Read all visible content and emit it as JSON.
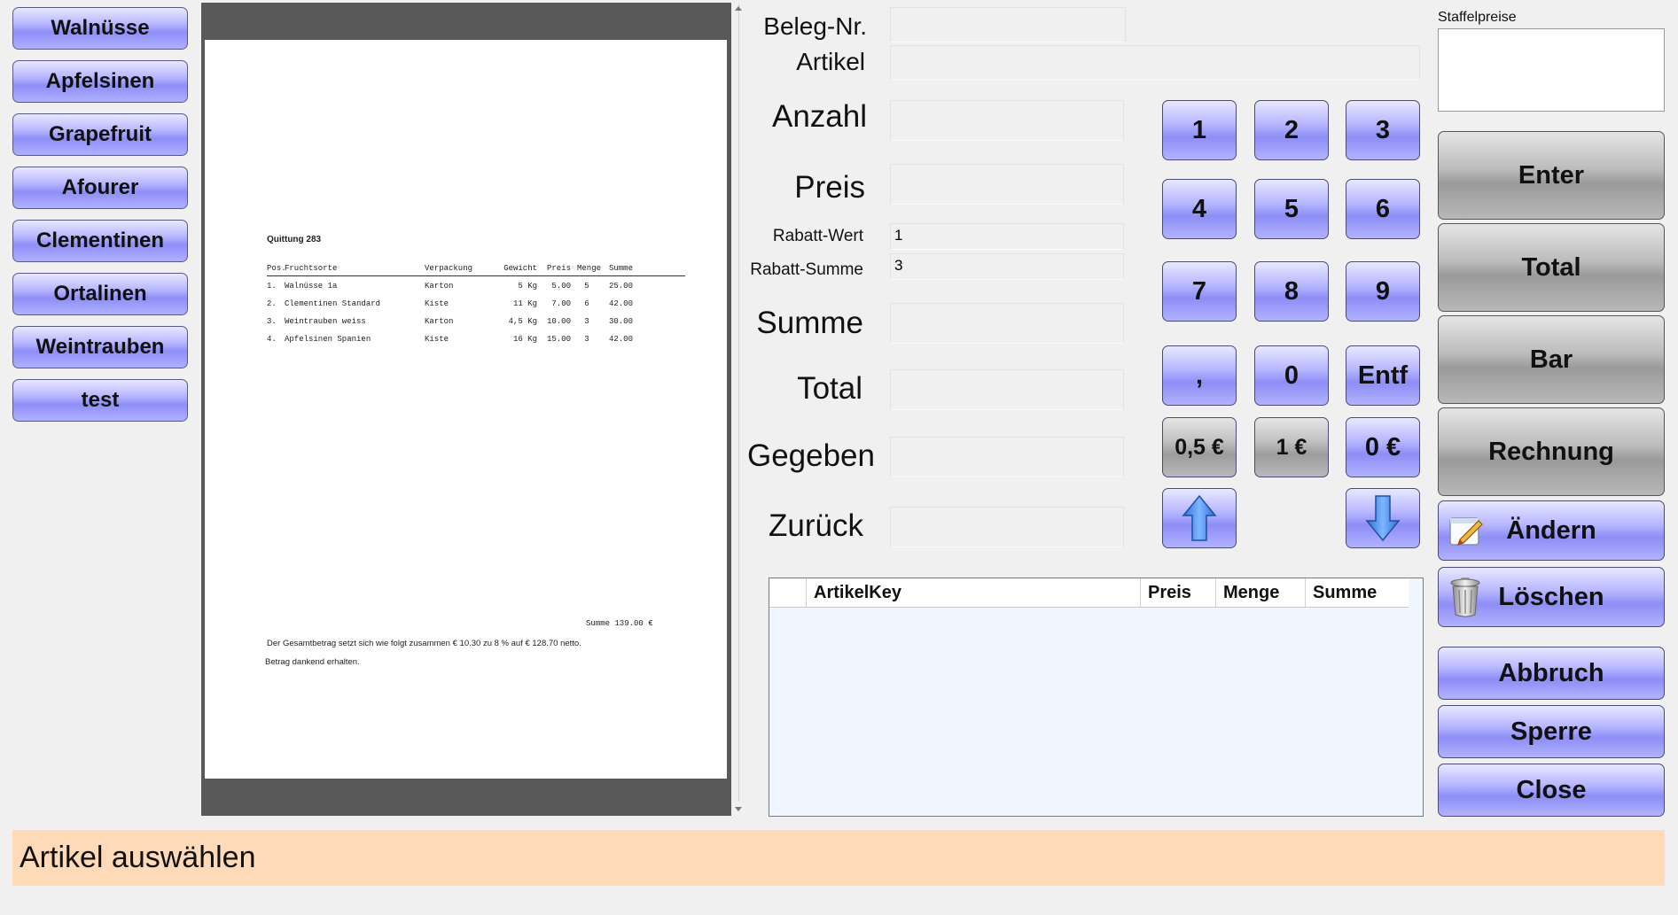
{
  "products": [
    "Walnüsse",
    "Apfelsinen",
    "Grapefruit",
    "Afourer",
    "Clementinen",
    "Ortalinen",
    "Weintrauben",
    "test"
  ],
  "receipt": {
    "title": "Quittung  283",
    "headers": [
      "Pos.",
      "Fruchtsorte",
      "Verpackung",
      "Gewicht",
      "Preis",
      "Menge",
      "Summe"
    ],
    "rows": [
      [
        "1.",
        "Walnüsse 1a",
        "Karton",
        "5 Kg",
        "5.00",
        "5",
        "25.00"
      ],
      [
        "2.",
        "Clementinen Standard",
        "Kiste",
        "11 Kg",
        "7.00",
        "6",
        "42.00"
      ],
      [
        "3.",
        "Weintrauben weiss",
        "Karton",
        "4,5 Kg",
        "10.00",
        "3",
        "30.00"
      ],
      [
        "4.",
        "Apfelsinen Spanien",
        "Kiste",
        "16 Kg",
        "15.00",
        "3",
        "42.00"
      ]
    ],
    "sum": "Summe 139.00 €",
    "note1": "Der Gesamtbetrag setzt sich wie folgt zusammen € 10.30 zu 8 % auf € 128.70 netto.",
    "note2": "Betrag dankend erhalten."
  },
  "form": {
    "beleg_label": "Beleg-Nr.",
    "beleg_value": "",
    "artikel_label": "Artikel",
    "artikel_value": "",
    "anzahl_label": "Anzahl",
    "anzahl_value": "",
    "preis_label": "Preis",
    "preis_value": "",
    "rabatt_wert_label": "Rabatt-Wert",
    "rabatt_wert_value": "1",
    "rabatt_summe_label": "Rabatt-Summe",
    "rabatt_summe_value": "3",
    "summe_label": "Summe",
    "summe_value": "",
    "total_label": "Total",
    "total_value": "",
    "gegeben_label": "Gegeben",
    "gegeben_value": "",
    "zurueck_label": "Zurück",
    "zurueck_value": ""
  },
  "keypad": {
    "k1": "1",
    "k2": "2",
    "k3": "3",
    "k4": "4",
    "k5": "5",
    "k6": "6",
    "k7": "7",
    "k8": "8",
    "k9": "9",
    "comma": ",",
    "k0": "0",
    "entf": "Entf",
    "c05": "0,5 €",
    "c1": "1 €",
    "c0": "0 €"
  },
  "right": {
    "staffel_label": "Staffelpreise",
    "enter": "Enter",
    "total": "Total",
    "bar": "Bar",
    "rechnung": "Rechnung",
    "aendern": "Ändern",
    "loeschen": "Löschen",
    "abbruch": "Abbruch",
    "sperre": "Sperre",
    "close": "Close"
  },
  "grid": {
    "columns": [
      "ArtikelKey",
      "Preis",
      "Menge",
      "Summe"
    ]
  },
  "status": "Artikel auswählen",
  "colors": {
    "status_bg": "#ffdab9",
    "button_purple": "#9d9dfb",
    "button_grey": "#b0b0b0"
  }
}
